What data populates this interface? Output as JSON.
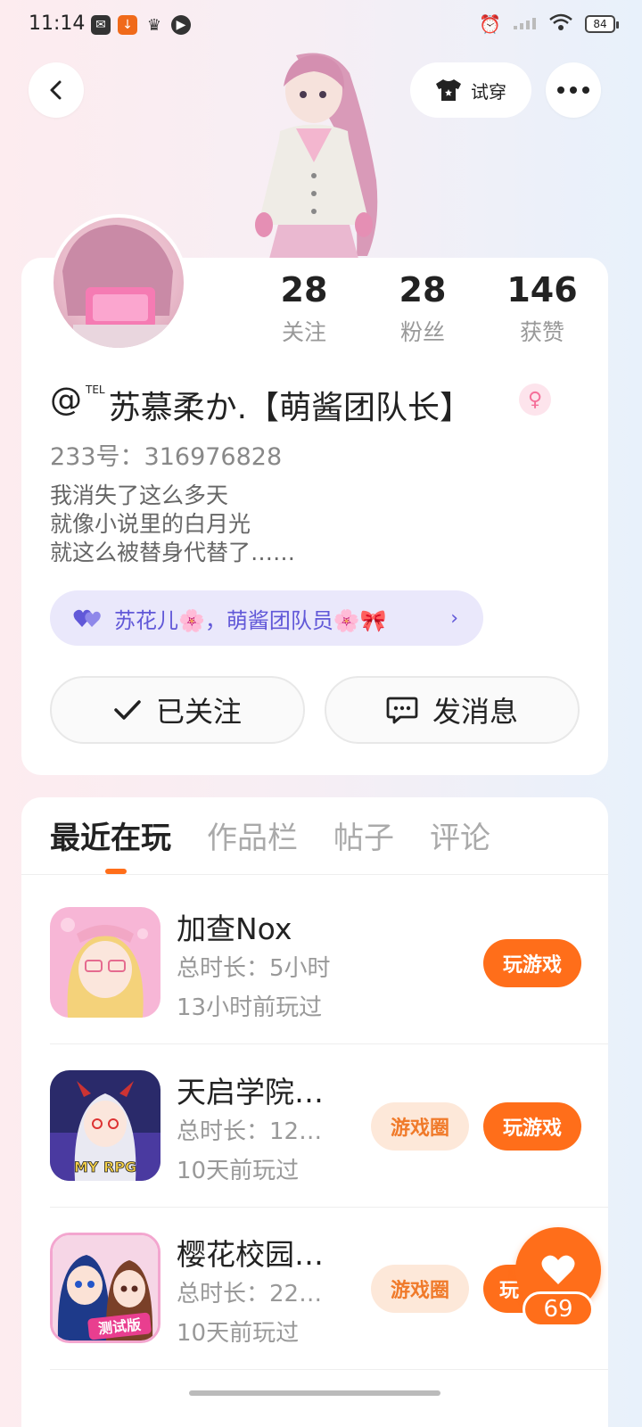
{
  "status_bar": {
    "time": "11:14",
    "battery": "84"
  },
  "header": {
    "tryon_label": "试穿"
  },
  "stats": [
    {
      "value": "28",
      "label": "关注"
    },
    {
      "value": "28",
      "label": "粉丝"
    },
    {
      "value": "146",
      "label": "获赞"
    }
  ],
  "profile": {
    "name_prefix": "@",
    "name_tel": "TEL",
    "name": "苏慕柔か.【萌酱团队长】",
    "account_id": "233号：316976828",
    "bio": [
      "我消失了这么多天",
      "就像小说里的白月光",
      "就这么被替身代替了……"
    ],
    "tag": "苏花儿🌸，萌酱团队员🌸🎀",
    "follow_label": "已关注",
    "message_label": "发消息"
  },
  "tabs": [
    "最近在玩",
    "作品栏",
    "帖子",
    "评论"
  ],
  "games": [
    {
      "name": "加查Nox",
      "duration": "总时长：5小时",
      "last_played": "13小时前玩过",
      "play_label": "玩游戏",
      "circle_label": ""
    },
    {
      "name": "天启学院…",
      "duration": "总时长：12…",
      "last_played": "10天前玩过",
      "play_label": "玩游戏",
      "circle_label": "游戏圈"
    },
    {
      "name": "樱花校园…",
      "duration": "总时长：22…",
      "last_played": "10天前玩过",
      "play_label": "玩",
      "circle_label": "游戏圈"
    }
  ],
  "game_icon_texts": {
    "rpg": "MY RPG",
    "test": "测试版"
  },
  "like_count": "69",
  "colors": {
    "accent": "#ff6e1a",
    "tag_bg": "#eae8fb",
    "tag_text": "#6158d8"
  }
}
